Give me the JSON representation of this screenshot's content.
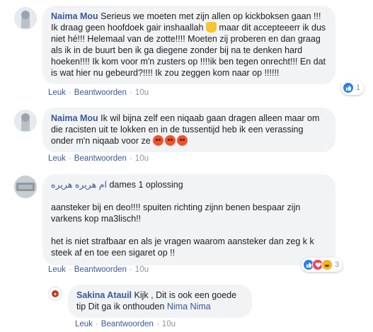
{
  "comments": [
    {
      "author": "Naima Mou",
      "text": "Serieus we moeten met zijn allen op kickboksen gaan !!! Ik draag geen hoofdoek gair inshaallah",
      "text_after_emoji": " maar dit accepteeerr ik dus niet hé!!! Helemaal van de zotte!!!! Moeten zij proberen en dan graag als ik in de buurt ben ik ga diegene zonder bij na te denken hard hoeken!!!! Ik kom voor m'n zusters op !!!!ik ben tegen onrecht!!! En dat is wat hier nu gebeurd?!!!! Ik zou zeggen kom naar op !!!!!!",
      "like": "Leuk",
      "reply": "Beantwoorden",
      "time": "10u",
      "reaction_count": "1"
    },
    {
      "author": "Naima Mou",
      "text": "Ik wil bijna zelf een niqaab gaan dragen alleen maar om die racisten uit te lokken en in de tussentijd heb ik een verassing onder m'n niqaab voor ze",
      "like": "Leuk",
      "reply": "Beantwoorden",
      "time": "10u"
    },
    {
      "author": "ام هريره هريره",
      "text_line1": "dames 1 oplossing",
      "text_para2": "aansteker bij en deo!!!! spuiten richting zijnn benen bespaar zijn varkens kop ma3lisch!!",
      "text_para3": "het is niet strafbaar en als je vragen waarom aansteker dan zeg k k steek af en toe een sigaret op !!",
      "like": "Leuk",
      "reply": "Beantwoorden",
      "time": "10u",
      "reaction_count": "3"
    },
    {
      "author": "Sakina Atauil",
      "text": "Kijk , Dit is ook een goede tip Dit ga ik onthouden",
      "mention": "Nima Nima",
      "like": "Leuk",
      "reply": "Beantwoorden",
      "time": "10u"
    }
  ],
  "colors": {
    "link": "#385898",
    "bubble": "#f2f3f5",
    "like_blue": "#2d7fe8",
    "heart_red": "#f33e58",
    "haha_yellow": "#f7b125"
  },
  "icons": [
    "like-reaction-icon",
    "heart-reaction-icon",
    "haha-reaction-icon",
    "angry-emoji-icon",
    "thumbs-up-emoji-icon"
  ]
}
